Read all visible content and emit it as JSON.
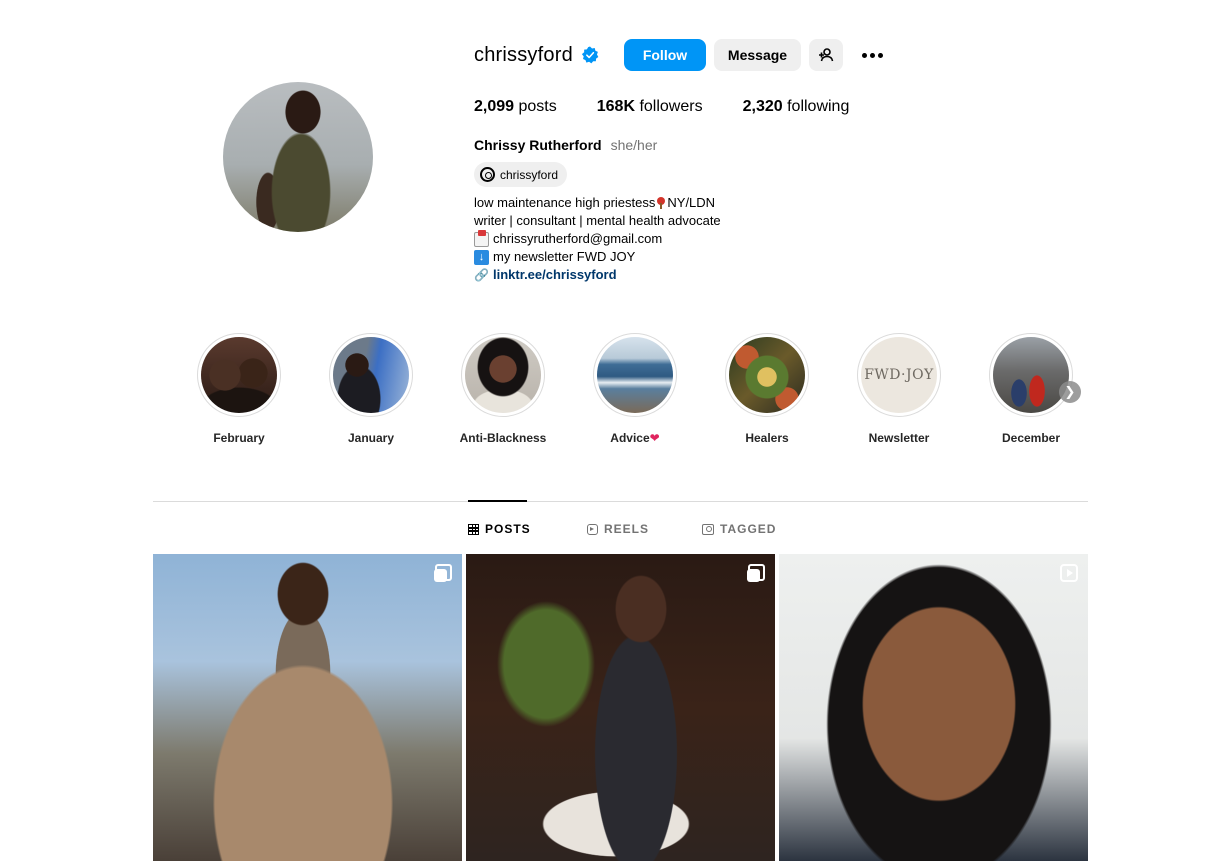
{
  "profile": {
    "username": "chrissyford",
    "verified": true,
    "follow_label": "Follow",
    "message_label": "Message",
    "stats": {
      "posts_count": "2,099",
      "posts_label": "posts",
      "followers_count": "168K",
      "followers_label": "followers",
      "following_count": "2,320",
      "following_label": "following"
    },
    "full_name": "Chrissy Rutherford",
    "pronouns": "she/her",
    "threads_handle": "chrissyford",
    "bio": {
      "line1_a": "low maintenance high priestess",
      "line1_b": "NY/LDN",
      "line2": "writer | consultant | mental health advocate",
      "line3": "chrissyrutherford@gmail.com",
      "line4": "my newsletter FWD JOY",
      "link": "linktr.ee/chrissyford"
    }
  },
  "highlights": [
    {
      "label": "February"
    },
    {
      "label": "January"
    },
    {
      "label": "Anti-Blackness"
    },
    {
      "label": "Advice",
      "emoji": "❤"
    },
    {
      "label": "Healers"
    },
    {
      "label": "Newsletter",
      "logo_text": "FWD·JOY"
    },
    {
      "label": "December"
    }
  ],
  "tabs": {
    "posts": "POSTS",
    "reels": "REELS",
    "tagged": "TAGGED"
  },
  "colors": {
    "accent": "#0095f6",
    "verified": "#0095f6",
    "link": "#00376b",
    "muted": "#737373",
    "heart": "#e0245e"
  }
}
